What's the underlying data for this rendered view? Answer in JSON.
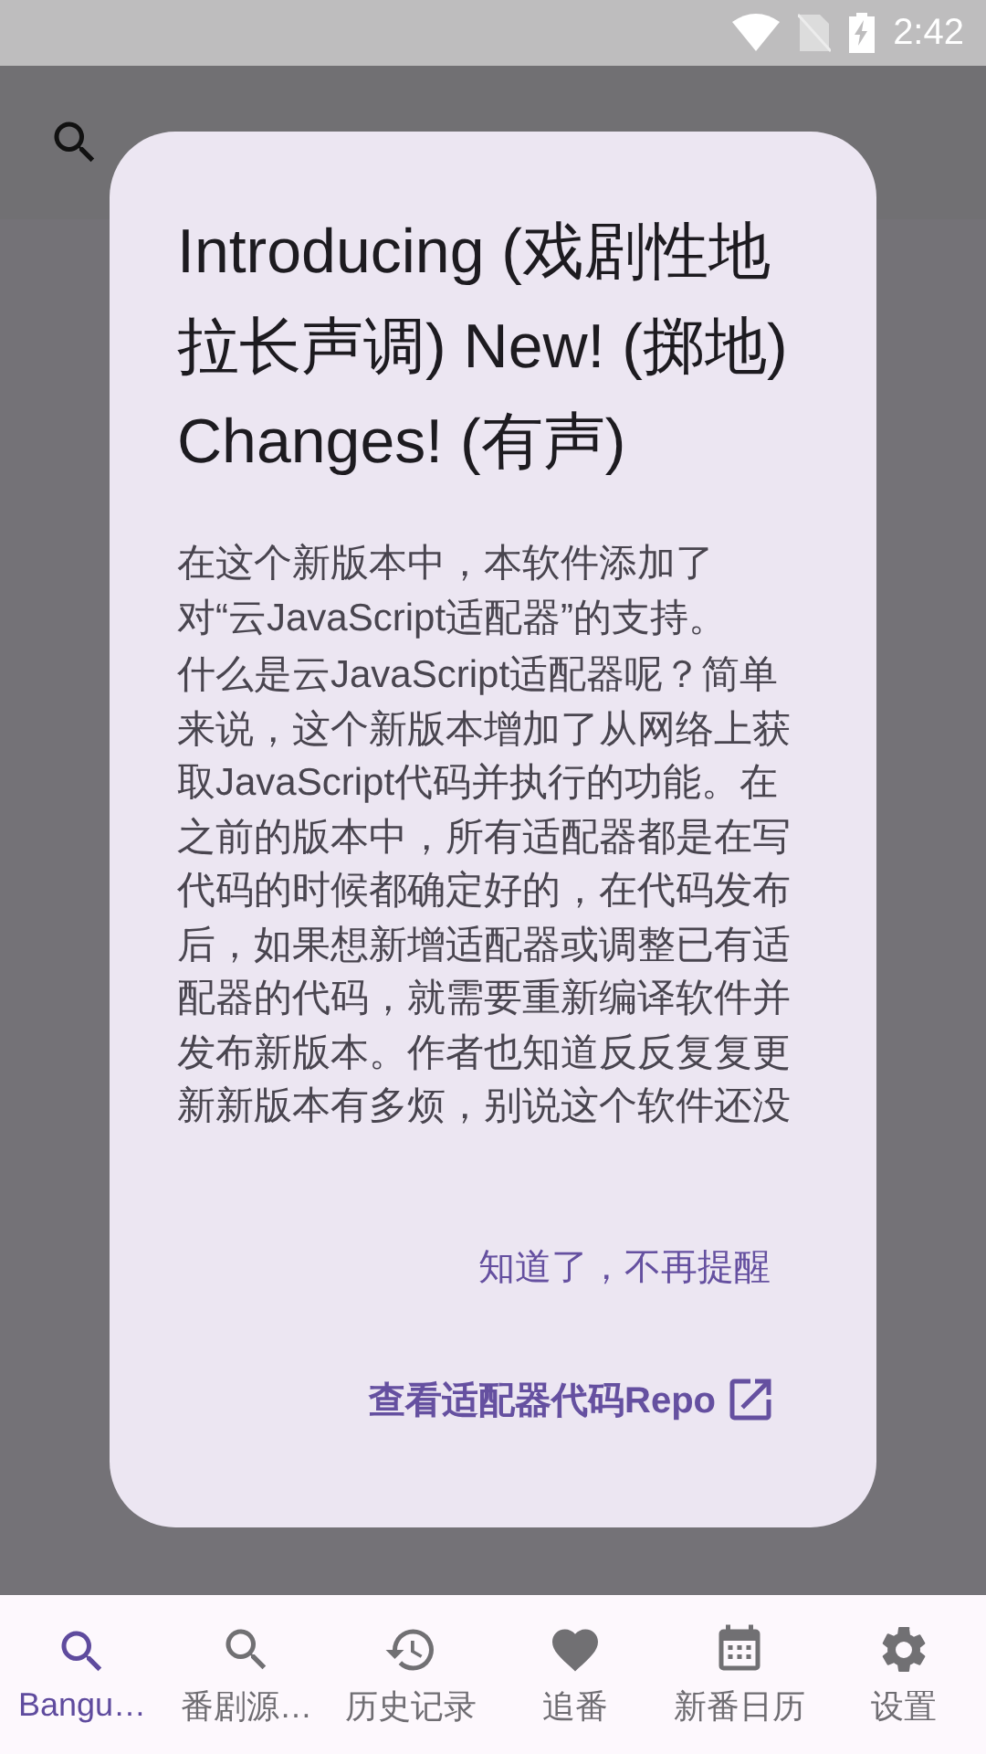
{
  "status_bar": {
    "time": "2:42"
  },
  "dialog": {
    "title": "Introducing (戏剧性地拉长声调) New! (掷地) Changes! (有声)",
    "paragraphs": [
      "在这个新版本中，本软件添加了对“云JavaScript适配器”的支持。",
      "什么是云JavaScript适配器呢？简单来说，这个新版本增加了从网络上获取JavaScript代码并执行的功能。在之前的版本中，所有适配器都是在写代码的时候都确定好的，在代码发布后，如果想新增适配器或调整已有适配器的代码，就需要重新编译软件并发布新版本。作者也知道反反复复更新新版本有多烦，别说这个软件还没"
    ],
    "actions": [
      {
        "label": "知道了，不再提醒",
        "kind": "text"
      },
      {
        "label": "查看适配器代码Repo",
        "kind": "link"
      }
    ]
  },
  "nav": [
    {
      "label": "Bangu…",
      "selected": true
    },
    {
      "label": "番剧源…",
      "selected": false
    },
    {
      "label": "历史记录",
      "selected": false
    },
    {
      "label": "追番",
      "selected": false
    },
    {
      "label": "新番日历",
      "selected": false
    },
    {
      "label": "设置",
      "selected": false
    }
  ]
}
